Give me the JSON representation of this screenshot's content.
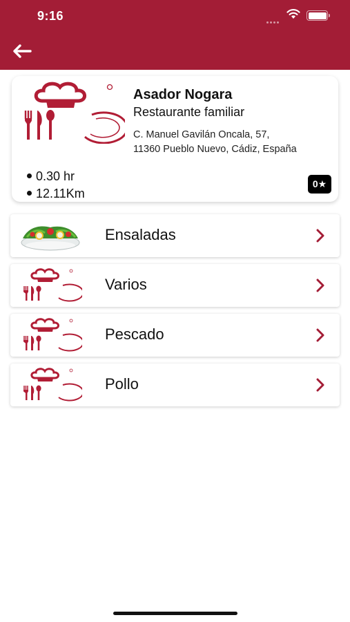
{
  "status_bar": {
    "time": "9:16"
  },
  "colors": {
    "brand": "#a31d36",
    "badge": "#000000"
  },
  "restaurant": {
    "name": "Asador Nogara",
    "type": "Restaurante familiar",
    "address_line1": "C. Manuel Gavilán Oncala, 57,",
    "address_line2": "11360 Pueblo Nuevo, Cádiz, España",
    "time": "0.30 hr",
    "distance": "12.11Km",
    "rating": "0★",
    "logo_icon": "chef-hat-cutlery-plate-logo"
  },
  "categories": [
    {
      "label": "Ensaladas",
      "icon": "salad-bowl-icon"
    },
    {
      "label": "Varios",
      "icon": "chef-logo-icon"
    },
    {
      "label": "Pescado",
      "icon": "chef-logo-icon"
    },
    {
      "label": "Pollo",
      "icon": "chef-logo-icon"
    }
  ]
}
